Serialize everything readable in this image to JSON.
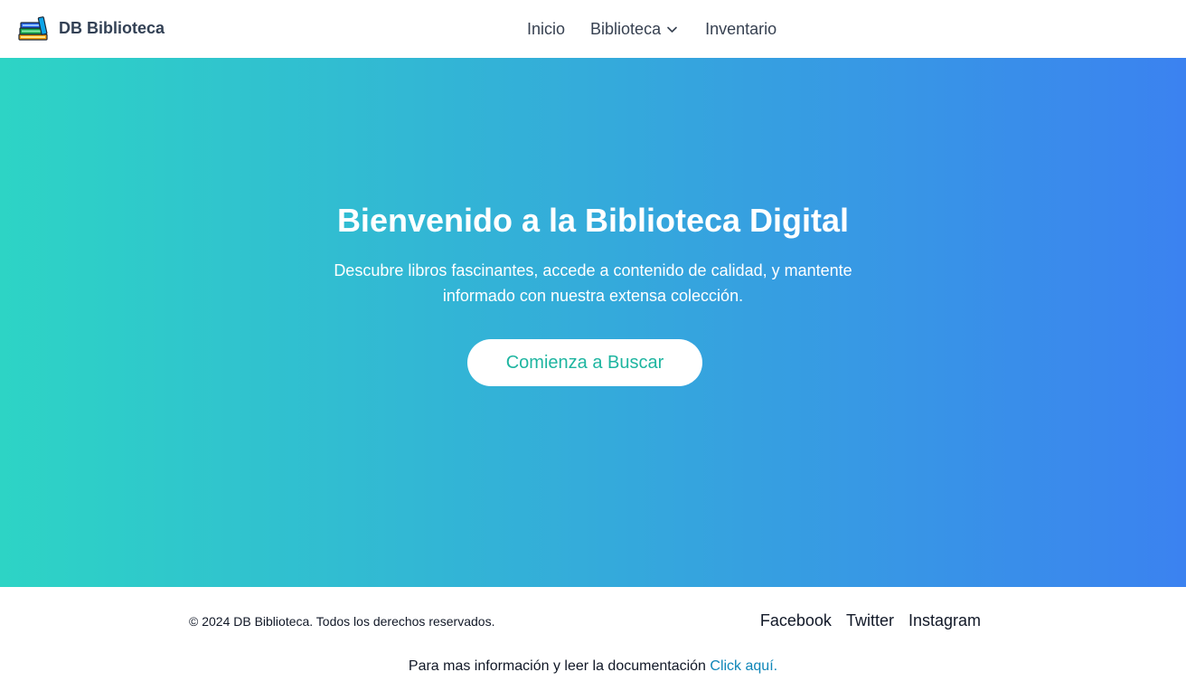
{
  "header": {
    "brand_name": "DB Biblioteca",
    "logo_icon": "books-stack-icon",
    "nav": {
      "inicio": "Inicio",
      "biblioteca": "Biblioteca",
      "inventario": "Inventario"
    }
  },
  "hero": {
    "title": "Bienvenido a la Biblioteca Digital",
    "subtitle_line1": "Descubre libros fascinantes, accede a contenido de calidad, y mantente",
    "subtitle_line2": "informado con nuestra extensa colección.",
    "cta_label": "Comienza a Buscar",
    "gradient_start": "#2dd4c5",
    "gradient_end": "#3b82f0",
    "cta_text_color": "#1eb5a0"
  },
  "footer": {
    "copyright": "© 2024 DB Biblioteca. Todos los derechos reservados.",
    "social": {
      "facebook": "Facebook",
      "twitter": "Twitter",
      "instagram": "Instagram"
    },
    "docs_text": "Para mas información y leer la documentación",
    "docs_link": "Click aquí.",
    "link_color": "#0e86b8"
  }
}
